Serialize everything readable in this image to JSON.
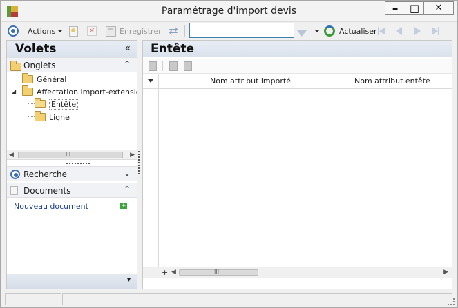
{
  "window": {
    "title": "Paramétrage d'import devis",
    "controls": {
      "minimize": "▬",
      "maximize": "□",
      "close": "✕"
    }
  },
  "toolbar": {
    "actions_label": "Actions",
    "save_label": "Enregistrer",
    "search_placeholder": "",
    "refresh_label": "Actualiser",
    "accent_color": "#3c6fb4"
  },
  "left_panel": {
    "title": "Volets",
    "collapse_glyph": "«",
    "sections": {
      "onglets": {
        "label": "Onglets",
        "chevron": "⌃"
      },
      "recherche": {
        "label": "Recherche",
        "chevron": "⌄"
      },
      "documents": {
        "label": "Documents",
        "chevron": "⌃"
      }
    },
    "tree": [
      {
        "label": "Général",
        "level": 1
      },
      {
        "label": "Affectation import-extensio",
        "level": 1,
        "expanded": true
      },
      {
        "label": "Entête",
        "level": 2,
        "selected": true
      },
      {
        "label": "Ligne",
        "level": 2
      }
    ],
    "new_document_label": "Nouveau document",
    "bottom_chevron": "▾",
    "scroll_thumb_glyph": "III"
  },
  "right_panel": {
    "title": "Entête",
    "grid": {
      "columns": [
        "Nom attribut importé",
        "Nom attribut entête"
      ],
      "rows": [],
      "footer_plus": "+",
      "scroll_thumb_glyph": "III"
    }
  }
}
